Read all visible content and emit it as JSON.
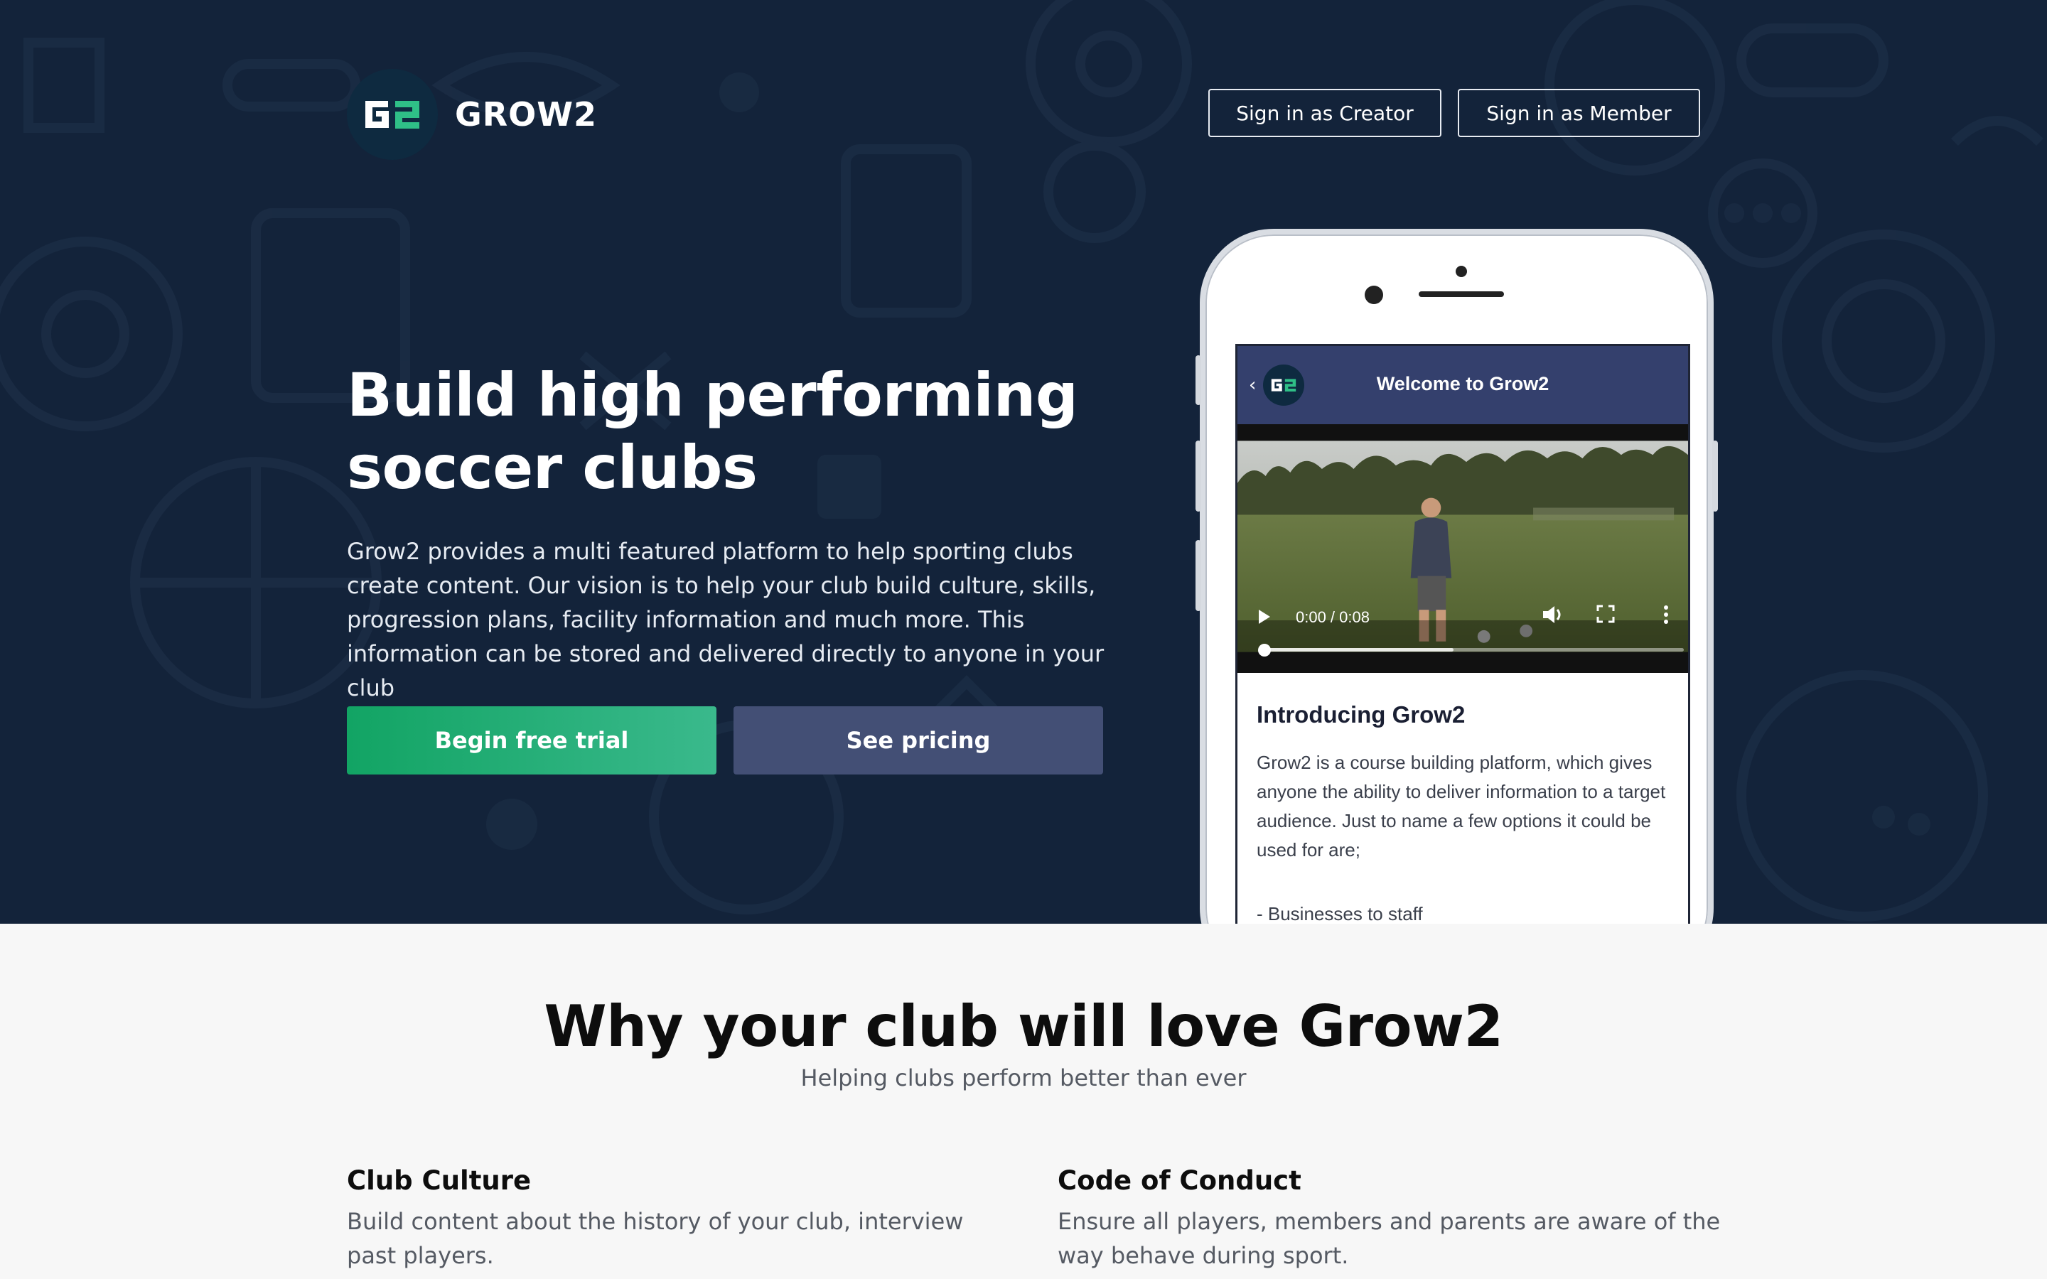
{
  "brand": {
    "name": "GROW2",
    "logo_icon": "g2-logo-icon",
    "logo_text": "G2"
  },
  "nav": {
    "creator_label": "Sign in as Creator",
    "member_label": "Sign in as Member"
  },
  "hero": {
    "title_line1": "Build high performing",
    "title_line2": "soccer clubs",
    "description": "Grow2 provides a multi featured platform to help sporting clubs create content. Our vision is to help your club build culture, skills, progression plans, facility information and much more. This information can be stored and delivered directly to anyone in your club",
    "cta_trial": "Begin free trial",
    "cta_pricing": "See pricing"
  },
  "phone": {
    "app_title": "Welcome to Grow2",
    "back_icon": "chevron-left-icon",
    "video": {
      "time": "0:00 / 0:08",
      "progress": 0.0,
      "buffered": 0.45
    },
    "intro_title": "Introducing Grow2",
    "intro_body": "Grow2 is a course building platform, which gives anyone the ability to deliver information to a target audience. Just to name a few options it could be used for are;",
    "intro_item": "- Businesses to staff"
  },
  "features": {
    "title": "Why your club will love Grow2",
    "subtitle": "Helping clubs perform better than ever",
    "items": [
      {
        "title": "Club Culture",
        "desc": "Build content about the history of your club, interview past players."
      },
      {
        "title": "Code of Conduct",
        "desc": "Ensure all players, members and parents are aware of the way behave during sport."
      }
    ]
  },
  "colors": {
    "hero_bg": "#13233a",
    "accent_green": "#12a464",
    "pricing_button": "#434f75",
    "app_bar": "#34406d"
  }
}
